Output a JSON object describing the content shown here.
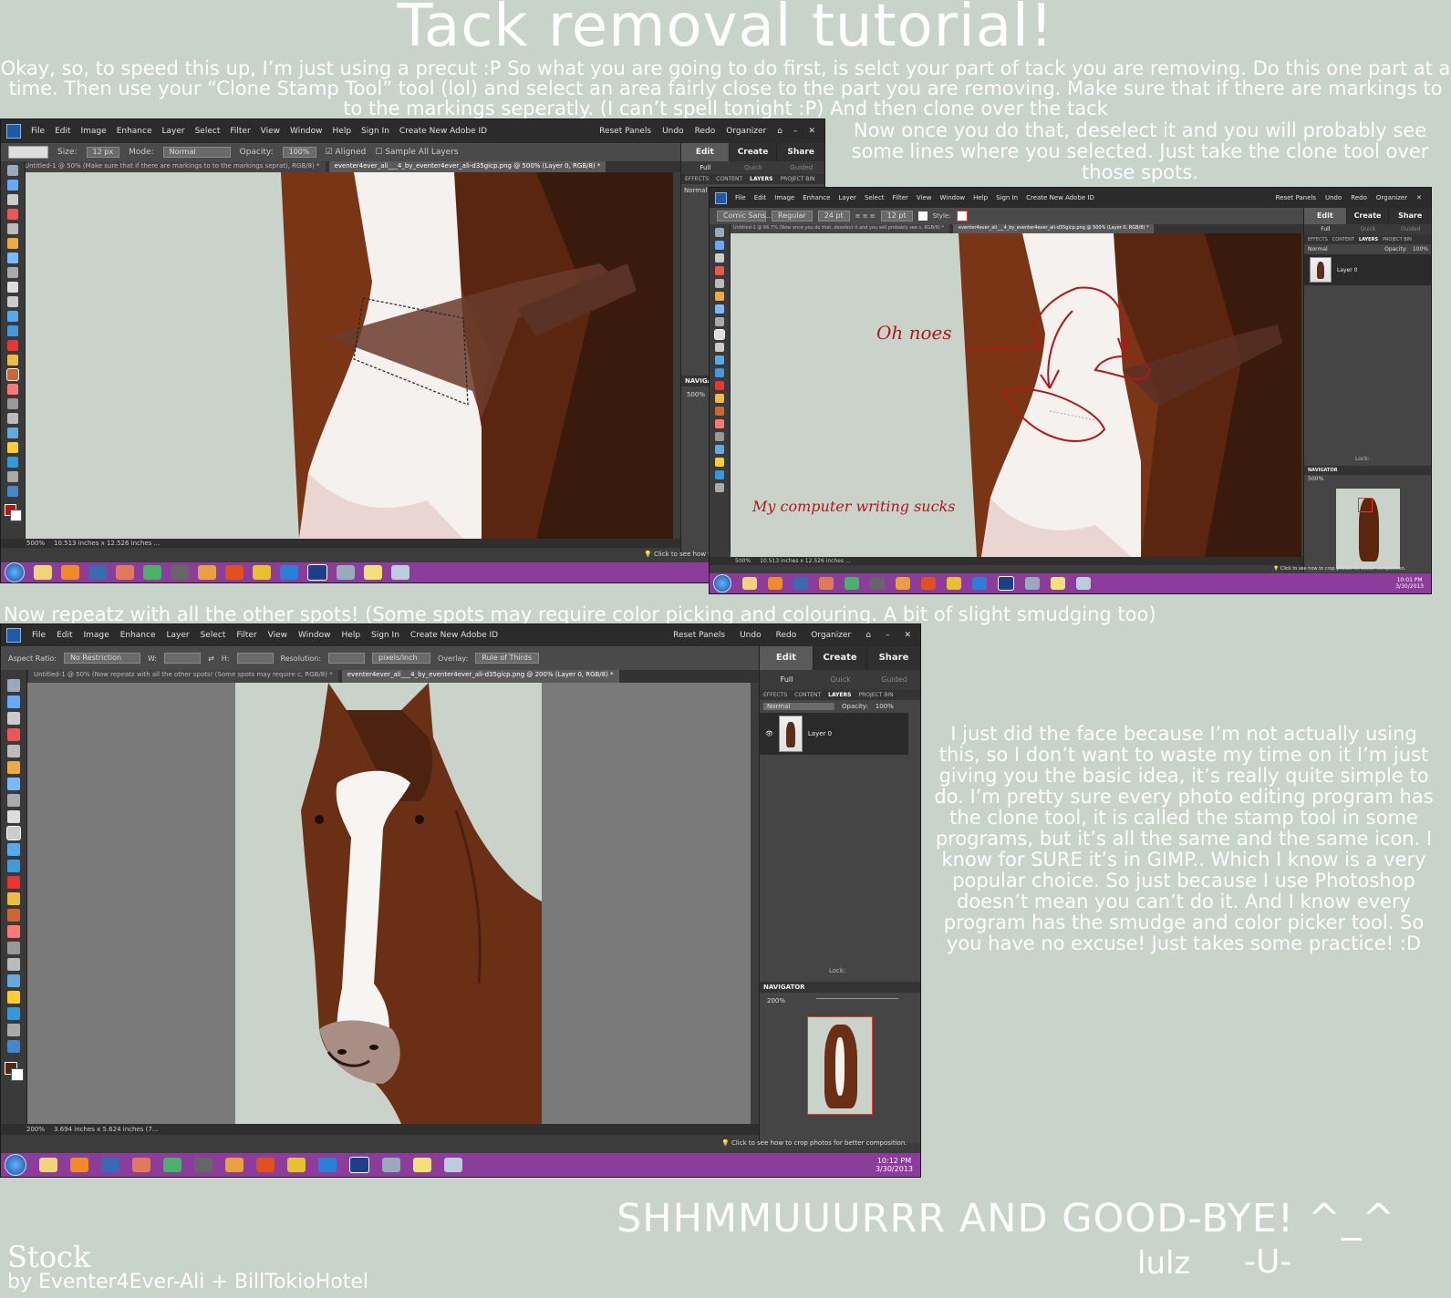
{
  "title": "Tack removal tutorial!",
  "intro": "Okay, so, to speed this up, I’m just using a precut :P So what you are going to do first, is selct your part of tack you are removing. Do this one part at a time. Then use your “Clone Stamp Tool” tool (lol) and select an area fairly close to the part you are removing. Make sure that if there are markings to to the markings seperatly. (I can’t spell tonight :P) And then clone over the tack",
  "step2_note": "Now once you do that, deselect it and you will probably see some lines where you selected. Just take the clone tool over those spots.",
  "repeat_note": "Now repeatz with all the other spots! (Some spots may require color picking and colouring. A bit of slight smudging too)",
  "side_note": "I just did the face because I’m not actually using this, so I don’t want to waste my time on it I’m just giving you the basic idea, it’s really quite simple to do. I’m pretty sure every photo editing program has the clone tool, it is called the stamp tool in some programs, but it’s all the same and the same icon. I know for SURE it’s in GIMP.. Which I know is a very popular choice. So just because I use Photoshop doesn’t mean you can’t do it. And I know every program has the smudge and color picker tool. So you have no excuse! Just takes some practice! :D",
  "goodbye": "SHHMMUUURRR AND GOOD-BYE! ^_^",
  "signature": "lulz",
  "signature_mark": "-U-",
  "stock_label": "Stock",
  "credit": "by Eventer4Ever-Ali + BillTokioHotel",
  "annotations": {
    "oh_noes": "Oh noes",
    "computer_writing": "My computer writing sucks"
  },
  "app": {
    "menu": [
      "File",
      "Edit",
      "Image",
      "Enhance",
      "Layer",
      "Select",
      "Filter",
      "View",
      "Window",
      "Help"
    ],
    "sign_in": "Sign In",
    "create_adobe_id": "Create New Adobe ID",
    "reset_panels": "Reset Panels",
    "undo": "Undo",
    "redo": "Redo",
    "organizer": "Organizer",
    "panel_tabs": [
      "Edit",
      "Create",
      "Share"
    ],
    "panel_sub": [
      "Full",
      "Quick",
      "Guided"
    ],
    "panel_labels": [
      "EFFECTS",
      "CONTENT",
      "LAYERS",
      "PROJECT BIN"
    ],
    "blend_mode": "Normal",
    "opacity_label": "Opacity:",
    "opacity_value": "100%",
    "layer_name": "Layer 0",
    "navigator": "NAVIGATOR",
    "lock_label": "Lock:",
    "hint": "Click to see how to crop photos for better composition."
  },
  "window1": {
    "size_label": "Size:",
    "size_value": "12 px",
    "mode_label": "Mode:",
    "mode_value": "Normal",
    "opacity_label": "Opacity:",
    "opacity_value": "100%",
    "aligned": "Aligned",
    "sample_all": "Sample All Layers",
    "tab1": "Untitled-1 @ 50% (Make sure that if there are markings to to the markings seprat), RGB/8) *",
    "tab2": "eventer4ever_ali___4_by_eventer4ever_ali-d35gicp.png @ 500% (Layer 0, RGB/8) *",
    "zoom": "500%",
    "doc_size": "10.513 inches x 12.526 inches ...",
    "nav_zoom": "500%",
    "hint": "Click to see how to c"
  },
  "window2": {
    "font": "Comic Sans...",
    "style": "Regular",
    "size1": "24 pt",
    "size2": "12 pt",
    "style_label": "Style:",
    "tab1": "Untitled-1 @ 66.7% (Now once you do that, deselect it and you will probably see s, RGB/8) *",
    "tab2": "eventer4ever_ali___4_by_eventer4ever_ali-d35gicp.png @ 500% (Layer 0, RGB/8) *",
    "zoom": "500%",
    "doc_size": "10.513 inches x 12.526 inches ...",
    "nav_zoom": "500%",
    "clock_time": "10:01 PM",
    "clock_date": "3/30/2013"
  },
  "window3": {
    "aspect_label": "Aspect Ratio:",
    "aspect_value": "No Restriction",
    "w_label": "W:",
    "h_label": "H:",
    "resolution_label": "Resolution:",
    "res_unit": "pixels/inch",
    "overlay_label": "Overlay:",
    "overlay_value": "Rule of Thirds",
    "tab1": "Untitled-1 @ 50% (Now repeatz with all the other spots! (Some spots may require c, RGB/8) *",
    "tab2": "eventer4ever_ali___4_by_eventer4ever_ali-d35gicp.png @ 200% (Layer 0, RGB/8) *",
    "zoom": "200%",
    "doc_size": "3.694 inches x 5.624 inches (7...",
    "nav_zoom": "200%",
    "clock_time": "10:12 PM",
    "clock_date": "3/30/2013"
  },
  "colors": {
    "background": "#c8d3ca",
    "taskbar": "#8c3d9c",
    "app_dark": "#3c3c3c",
    "horse_brown": "#6b2f16",
    "annotation_red": "#b01818"
  }
}
